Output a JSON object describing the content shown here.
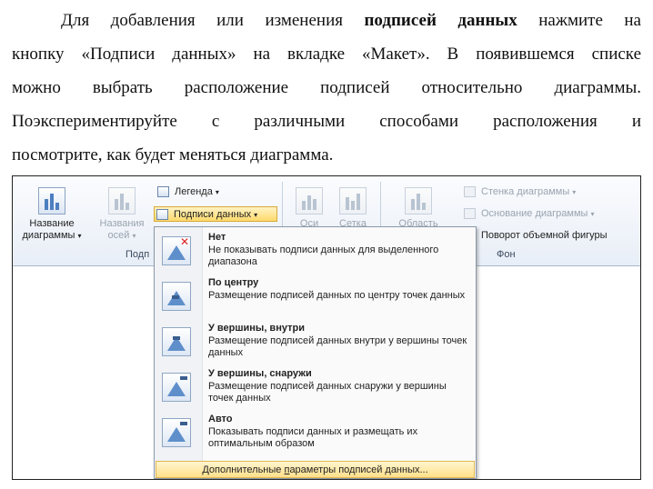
{
  "paragraph": {
    "lines": [
      {
        "pre": "Для добавления или изменения ",
        "bold": "подписей данных",
        "post": " нажмите на"
      },
      {
        "pre": "кнопку «Подписи данных» на вкладке «Макет». В появившемся списке"
      },
      {
        "pre": "можно выбрать расположение подписей относительно диаграммы."
      },
      {
        "pre": "Поэкспериментируйте с различными способами расположения и"
      },
      {
        "pre": "посмотрите, как будет меняться диаграмма."
      }
    ]
  },
  "ribbon": {
    "chart_title_button": {
      "line1": "Название",
      "line2": "диаграммы",
      "arrow": "▾"
    },
    "axis_title_button": {
      "line1": "Названия",
      "line2": "осей",
      "arrow": "▾"
    },
    "legend_button": {
      "label": "Легенда",
      "arrow": "▾"
    },
    "data_labels_button": {
      "label": "Подписи данных",
      "arrow": "▾"
    },
    "labels_group_label": "Подп",
    "axes_button": {
      "label": "Оси"
    },
    "gridlines_button": {
      "label": "Сетка"
    },
    "plot_area_button": {
      "label": "Область"
    },
    "chart_wall_button": {
      "label": "Стенка диаграммы",
      "arrow": "▾"
    },
    "chart_floor_button": {
      "label": "Основание диаграммы",
      "arrow": "▾"
    },
    "rotation_button": {
      "label": "Поворот объемной фигуры"
    },
    "background_group_label": "Фон"
  },
  "menu": {
    "items": [
      {
        "title": "Нет",
        "desc": "Не показывать подписи данных для выделенного диапазона",
        "icon": "no-labels-icon"
      },
      {
        "title": "По центру",
        "desc": "Размещение подписей данных по центру точек данных",
        "icon": "center-labels-icon"
      },
      {
        "title": "У вершины, внутри",
        "desc": "Размещение подписей данных внутри у вершины точек данных",
        "icon": "inside-end-labels-icon"
      },
      {
        "title": "У вершины, снаружи",
        "desc": "Размещение подписей данных снаружи у вершины точек данных",
        "icon": "outside-end-labels-icon"
      },
      {
        "title": "Авто",
        "desc": "Показывать подписи данных и размещать их оптимальным образом",
        "icon": "auto-labels-icon"
      }
    ],
    "more_options": {
      "pre": "Дополнительные ",
      "underlined": "п",
      "post": "араметры подписей данных..."
    }
  },
  "colors": {
    "ribbon_bg": "#e8eef7",
    "active_highlight": "#ffd96b",
    "menu_border": "#8b98a8"
  }
}
